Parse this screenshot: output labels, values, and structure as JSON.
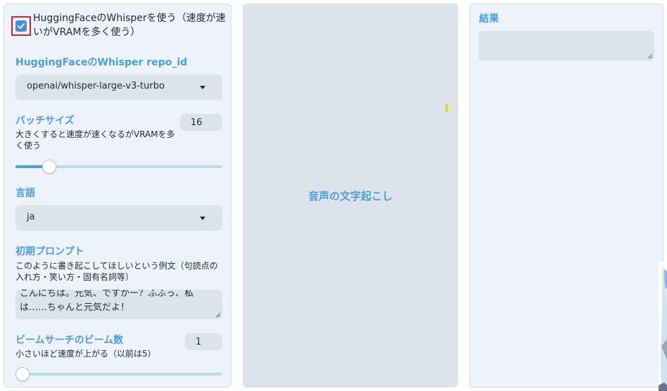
{
  "settings": {
    "use_hf_whisper": {
      "checked": true,
      "label_line1": "HuggingFaceのWhisperを使う（速度が速",
      "label_line2": "いがVRAMを多く使う）"
    },
    "repo_id": {
      "label": "HuggingFaceのWhisper repo_id",
      "value": "openai/whisper-large-v3-turbo"
    },
    "batch_size": {
      "label": "バッチサイズ",
      "help_line1": "大きくすると速度が速くなるがVRAMを多",
      "help_line2": "く使う",
      "value": "16",
      "slider_fraction": 0.14
    },
    "language": {
      "label": "言語",
      "value": "ja"
    },
    "initial_prompt": {
      "label": "初期プロンプト",
      "help_line1": "このように書き起こしてほしいという例文（句読点の",
      "help_line2": "入れ方・笑い方・固有名詞等）",
      "value_line1": "こんにちは。元気、ですかー？ふふっ、私",
      "value_line2": "は……ちゃんと元気だよ！"
    },
    "beam_size": {
      "label": "ビームサーチのビーム数",
      "help": "小さいほど速度が上がる（以前は5）",
      "value": "1",
      "slider_fraction": 0.0
    }
  },
  "actions": {
    "transcribe_label": "音声の文字起こし"
  },
  "result": {
    "label": "結果",
    "value": ""
  },
  "colors": {
    "accent": "#4a9fdf",
    "panel_bg": "#eef3fb",
    "input_bg": "#dde3ea",
    "highlight_box": "#e0202a"
  }
}
